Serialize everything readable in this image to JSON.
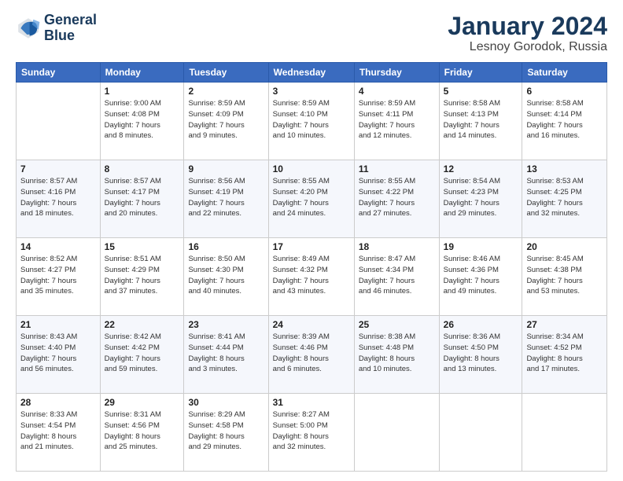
{
  "logo": {
    "line1": "General",
    "line2": "Blue"
  },
  "header": {
    "month": "January 2024",
    "location": "Lesnoy Gorodok, Russia"
  },
  "days_of_week": [
    "Sunday",
    "Monday",
    "Tuesday",
    "Wednesday",
    "Thursday",
    "Friday",
    "Saturday"
  ],
  "weeks": [
    [
      {
        "day": "",
        "info": ""
      },
      {
        "day": "1",
        "info": "Sunrise: 9:00 AM\nSunset: 4:08 PM\nDaylight: 7 hours\nand 8 minutes."
      },
      {
        "day": "2",
        "info": "Sunrise: 8:59 AM\nSunset: 4:09 PM\nDaylight: 7 hours\nand 9 minutes."
      },
      {
        "day": "3",
        "info": "Sunrise: 8:59 AM\nSunset: 4:10 PM\nDaylight: 7 hours\nand 10 minutes."
      },
      {
        "day": "4",
        "info": "Sunrise: 8:59 AM\nSunset: 4:11 PM\nDaylight: 7 hours\nand 12 minutes."
      },
      {
        "day": "5",
        "info": "Sunrise: 8:58 AM\nSunset: 4:13 PM\nDaylight: 7 hours\nand 14 minutes."
      },
      {
        "day": "6",
        "info": "Sunrise: 8:58 AM\nSunset: 4:14 PM\nDaylight: 7 hours\nand 16 minutes."
      }
    ],
    [
      {
        "day": "7",
        "info": "Sunrise: 8:57 AM\nSunset: 4:16 PM\nDaylight: 7 hours\nand 18 minutes."
      },
      {
        "day": "8",
        "info": "Sunrise: 8:57 AM\nSunset: 4:17 PM\nDaylight: 7 hours\nand 20 minutes."
      },
      {
        "day": "9",
        "info": "Sunrise: 8:56 AM\nSunset: 4:19 PM\nDaylight: 7 hours\nand 22 minutes."
      },
      {
        "day": "10",
        "info": "Sunrise: 8:55 AM\nSunset: 4:20 PM\nDaylight: 7 hours\nand 24 minutes."
      },
      {
        "day": "11",
        "info": "Sunrise: 8:55 AM\nSunset: 4:22 PM\nDaylight: 7 hours\nand 27 minutes."
      },
      {
        "day": "12",
        "info": "Sunrise: 8:54 AM\nSunset: 4:23 PM\nDaylight: 7 hours\nand 29 minutes."
      },
      {
        "day": "13",
        "info": "Sunrise: 8:53 AM\nSunset: 4:25 PM\nDaylight: 7 hours\nand 32 minutes."
      }
    ],
    [
      {
        "day": "14",
        "info": "Sunrise: 8:52 AM\nSunset: 4:27 PM\nDaylight: 7 hours\nand 35 minutes."
      },
      {
        "day": "15",
        "info": "Sunrise: 8:51 AM\nSunset: 4:29 PM\nDaylight: 7 hours\nand 37 minutes."
      },
      {
        "day": "16",
        "info": "Sunrise: 8:50 AM\nSunset: 4:30 PM\nDaylight: 7 hours\nand 40 minutes."
      },
      {
        "day": "17",
        "info": "Sunrise: 8:49 AM\nSunset: 4:32 PM\nDaylight: 7 hours\nand 43 minutes."
      },
      {
        "day": "18",
        "info": "Sunrise: 8:47 AM\nSunset: 4:34 PM\nDaylight: 7 hours\nand 46 minutes."
      },
      {
        "day": "19",
        "info": "Sunrise: 8:46 AM\nSunset: 4:36 PM\nDaylight: 7 hours\nand 49 minutes."
      },
      {
        "day": "20",
        "info": "Sunrise: 8:45 AM\nSunset: 4:38 PM\nDaylight: 7 hours\nand 53 minutes."
      }
    ],
    [
      {
        "day": "21",
        "info": "Sunrise: 8:43 AM\nSunset: 4:40 PM\nDaylight: 7 hours\nand 56 minutes."
      },
      {
        "day": "22",
        "info": "Sunrise: 8:42 AM\nSunset: 4:42 PM\nDaylight: 7 hours\nand 59 minutes."
      },
      {
        "day": "23",
        "info": "Sunrise: 8:41 AM\nSunset: 4:44 PM\nDaylight: 8 hours\nand 3 minutes."
      },
      {
        "day": "24",
        "info": "Sunrise: 8:39 AM\nSunset: 4:46 PM\nDaylight: 8 hours\nand 6 minutes."
      },
      {
        "day": "25",
        "info": "Sunrise: 8:38 AM\nSunset: 4:48 PM\nDaylight: 8 hours\nand 10 minutes."
      },
      {
        "day": "26",
        "info": "Sunrise: 8:36 AM\nSunset: 4:50 PM\nDaylight: 8 hours\nand 13 minutes."
      },
      {
        "day": "27",
        "info": "Sunrise: 8:34 AM\nSunset: 4:52 PM\nDaylight: 8 hours\nand 17 minutes."
      }
    ],
    [
      {
        "day": "28",
        "info": "Sunrise: 8:33 AM\nSunset: 4:54 PM\nDaylight: 8 hours\nand 21 minutes."
      },
      {
        "day": "29",
        "info": "Sunrise: 8:31 AM\nSunset: 4:56 PM\nDaylight: 8 hours\nand 25 minutes."
      },
      {
        "day": "30",
        "info": "Sunrise: 8:29 AM\nSunset: 4:58 PM\nDaylight: 8 hours\nand 29 minutes."
      },
      {
        "day": "31",
        "info": "Sunrise: 8:27 AM\nSunset: 5:00 PM\nDaylight: 8 hours\nand 32 minutes."
      },
      {
        "day": "",
        "info": ""
      },
      {
        "day": "",
        "info": ""
      },
      {
        "day": "",
        "info": ""
      }
    ]
  ]
}
